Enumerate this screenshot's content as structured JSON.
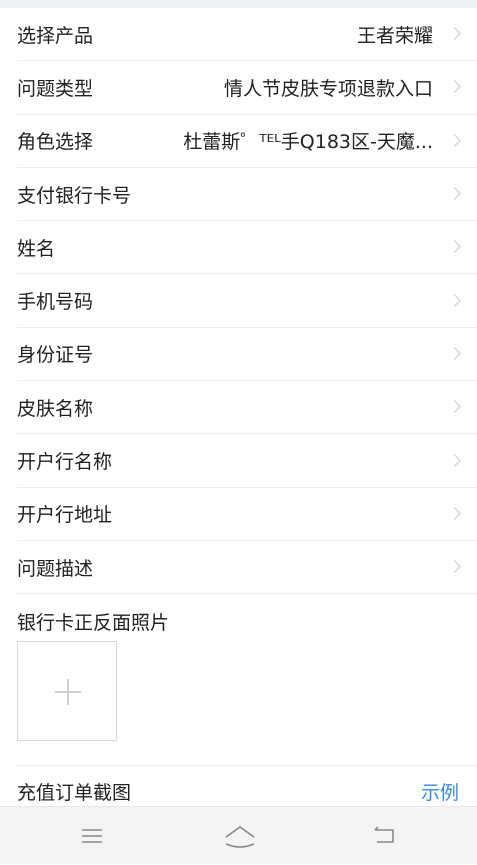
{
  "form": {
    "rows": [
      {
        "label": "选择产品",
        "value": "王者荣耀"
      },
      {
        "label": "问题类型",
        "value": "情人节皮肤专项退款入口"
      },
      {
        "label": "角色选择",
        "value": "杜蕾斯゜ᵀᴱᴸ手Q183区-天魔..."
      },
      {
        "label": "支付银行卡号",
        "value": ""
      },
      {
        "label": "姓名",
        "value": ""
      },
      {
        "label": "手机号码",
        "value": ""
      },
      {
        "label": "身份证号",
        "value": ""
      },
      {
        "label": "皮肤名称",
        "value": ""
      },
      {
        "label": "开户行名称",
        "value": ""
      },
      {
        "label": "开户行地址",
        "value": ""
      },
      {
        "label": "问题描述",
        "value": ""
      }
    ],
    "bank_photo_label": "银行卡正反面照片",
    "recharge_label": "充值订单截图",
    "example_link": "示例"
  },
  "icons": {
    "row_arrow": "chevron-right-icon",
    "upload": "plus-icon",
    "nav_menu": "menu-icon",
    "nav_home": "home-icon",
    "nav_back": "back-icon"
  },
  "colors": {
    "link": "#2f8ae5",
    "text": "#222222",
    "divider": "#ececec",
    "navbar": "#f4f4f4"
  }
}
